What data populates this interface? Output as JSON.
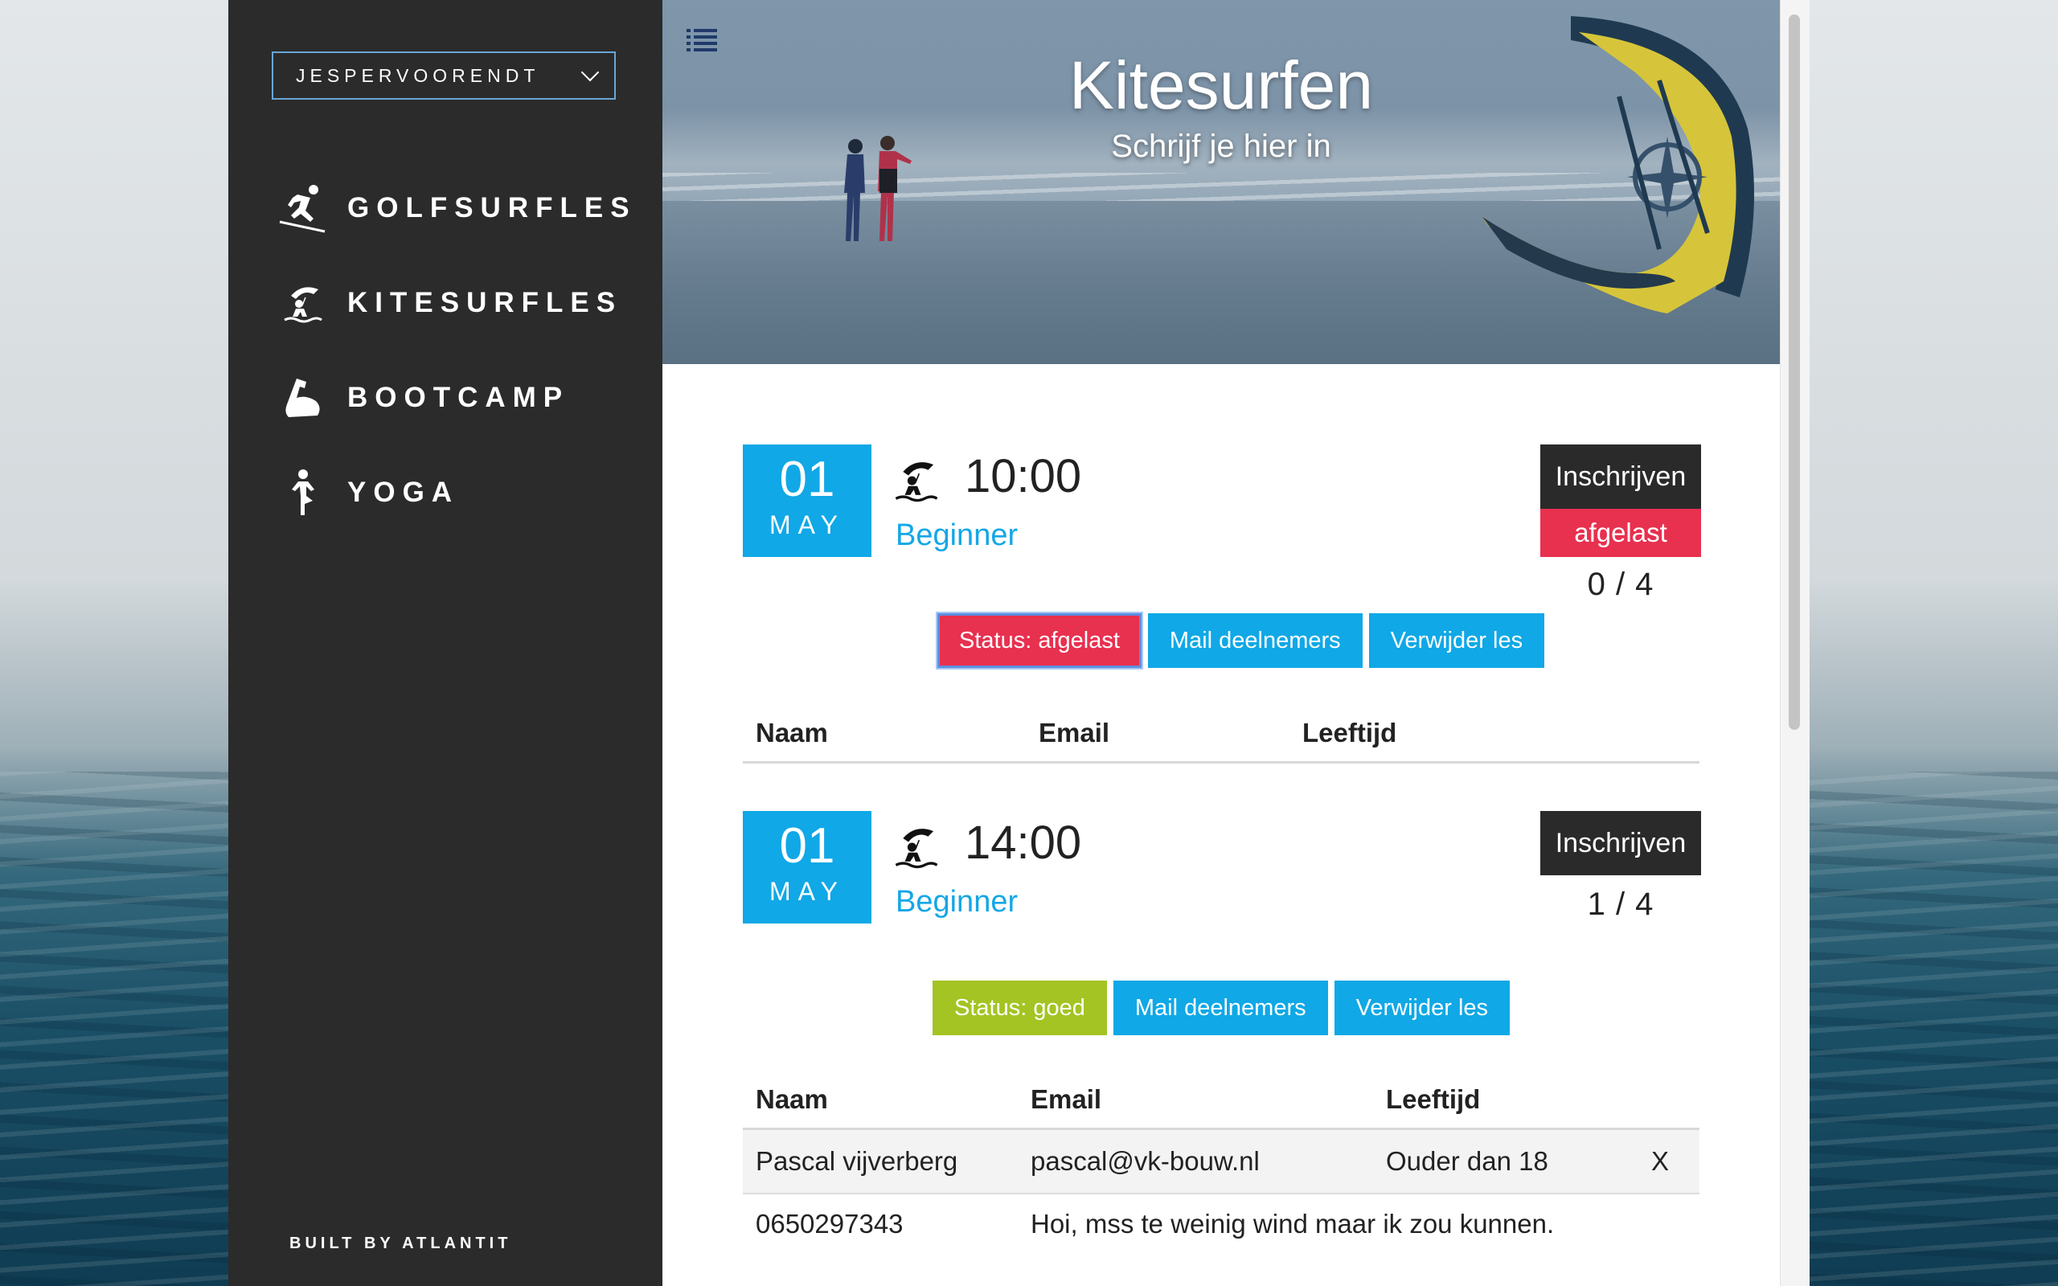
{
  "sidebar": {
    "user_select": "JESPERVOORENDT",
    "items": [
      {
        "label": "GOLFSURFLES",
        "icon": "surfer-icon"
      },
      {
        "label": "KITESURFLES",
        "icon": "kitesurfer-icon"
      },
      {
        "label": "BOOTCAMP",
        "icon": "flexed-arm-icon"
      },
      {
        "label": "YOGA",
        "icon": "yoga-pose-icon"
      }
    ],
    "footer": "BUILT BY ATLANTIT"
  },
  "hero": {
    "title": "Kitesurfen",
    "subtitle": "Schrijf je hier in"
  },
  "lessons": [
    {
      "day": "01",
      "month": "MAY",
      "time": "10:00",
      "level": "Beginner",
      "signup_label": "Inschrijven",
      "cancel_label": "afgelast",
      "count": "0 / 4",
      "status_label": "Status: afgelast",
      "status_color": "#e8304f",
      "mail_label": "Mail deelnemers",
      "delete_label": "Verwijder les",
      "table_headers": [
        "Naam",
        "Email",
        "Leeftijd"
      ],
      "participants": []
    },
    {
      "day": "01",
      "month": "MAY",
      "time": "14:00",
      "level": "Beginner",
      "signup_label": "Inschrijven",
      "count": "1 / 4",
      "status_label": "Status: goed",
      "status_color": "#a3c423",
      "mail_label": "Mail deelnemers",
      "delete_label": "Verwijder les",
      "table_headers": [
        "Naam",
        "Email",
        "Leeftijd"
      ],
      "participants": [
        {
          "name": "Pascal vijverberg",
          "email": "pascal@vk-bouw.nl",
          "age": "Ouder dan 18",
          "remove": "X",
          "phone": "0650297343",
          "note": "Hoi, mss te weinig wind maar ik zou kunnen."
        }
      ]
    }
  ],
  "colors": {
    "accent": "#10a8e6",
    "danger": "#e8304f",
    "success": "#a3c423",
    "sidebar": "#2b2b2b"
  }
}
